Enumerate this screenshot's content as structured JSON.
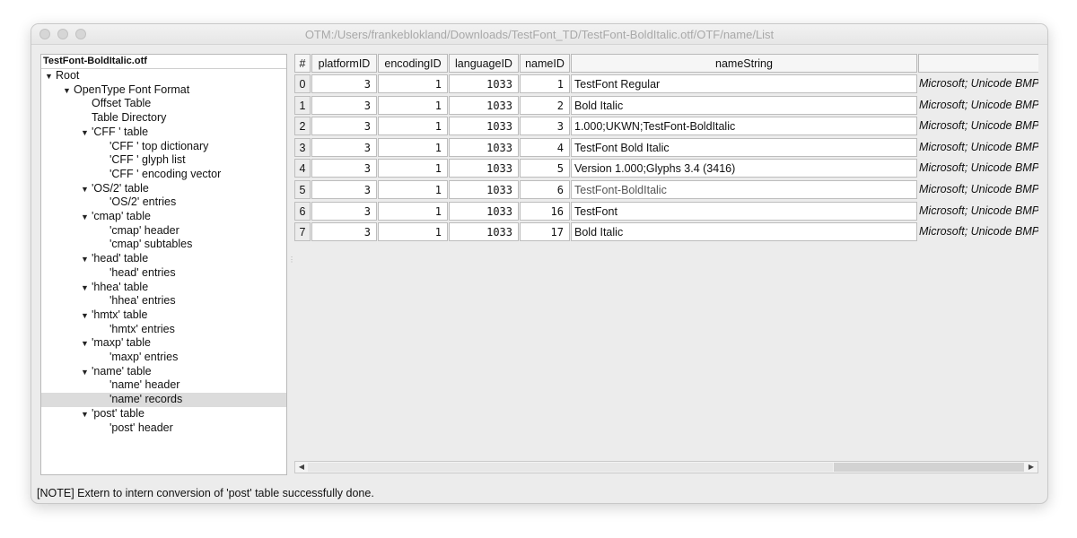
{
  "window": {
    "title": "OTM:/Users/frankeblokland/Downloads/TestFont_TD/TestFont-BoldItalic.otf/OTF/name/List"
  },
  "tree": {
    "header": "TestFont-BoldItalic.otf",
    "items": [
      {
        "label": "Root",
        "expanded": true
      },
      {
        "label": "OpenType Font Format",
        "expanded": true
      },
      {
        "label": "Offset Table"
      },
      {
        "label": "Table Directory"
      },
      {
        "label": "'CFF ' table",
        "expanded": true
      },
      {
        "label": "'CFF ' top dictionary"
      },
      {
        "label": "'CFF ' glyph list"
      },
      {
        "label": "'CFF ' encoding vector"
      },
      {
        "label": "'OS/2' table",
        "expanded": true
      },
      {
        "label": "'OS/2' entries"
      },
      {
        "label": "'cmap' table",
        "expanded": true
      },
      {
        "label": "'cmap' header"
      },
      {
        "label": "'cmap' subtables"
      },
      {
        "label": "'head' table",
        "expanded": true
      },
      {
        "label": "'head' entries"
      },
      {
        "label": "'hhea' table",
        "expanded": true
      },
      {
        "label": "'hhea' entries"
      },
      {
        "label": "'hmtx' table",
        "expanded": true
      },
      {
        "label": "'hmtx' entries"
      },
      {
        "label": "'maxp' table",
        "expanded": true
      },
      {
        "label": "'maxp' entries"
      },
      {
        "label": "'name' table",
        "expanded": true
      },
      {
        "label": "'name' header"
      },
      {
        "label": "'name' records",
        "selected": true
      },
      {
        "label": "'post' table",
        "expanded": true
      },
      {
        "label": "'post' header"
      }
    ]
  },
  "table": {
    "columns": [
      "#",
      "platformID",
      "encodingID",
      "languageID",
      "nameID",
      "nameString",
      ""
    ],
    "rows": [
      {
        "idx": "0",
        "platformID": "3",
        "encodingID": "1",
        "languageID": "1033",
        "nameID": "1",
        "nameString": "TestFont Regular",
        "platform": "Microsoft; Unicode BMP"
      },
      {
        "idx": "1",
        "platformID": "3",
        "encodingID": "1",
        "languageID": "1033",
        "nameID": "2",
        "nameString": "Bold Italic",
        "platform": "Microsoft; Unicode BMP"
      },
      {
        "idx": "2",
        "platformID": "3",
        "encodingID": "1",
        "languageID": "1033",
        "nameID": "3",
        "nameString": "1.000;UKWN;TestFont-BoldItalic",
        "platform": "Microsoft; Unicode BMP"
      },
      {
        "idx": "3",
        "platformID": "3",
        "encodingID": "1",
        "languageID": "1033",
        "nameID": "4",
        "nameString": "TestFont Bold Italic",
        "platform": "Microsoft; Unicode BMP"
      },
      {
        "idx": "4",
        "platformID": "3",
        "encodingID": "1",
        "languageID": "1033",
        "nameID": "5",
        "nameString": "Version 1.000;Glyphs 3.4 (3416)",
        "platform": "Microsoft; Unicode BMP"
      },
      {
        "idx": "5",
        "platformID": "3",
        "encodingID": "1",
        "languageID": "1033",
        "nameID": "6",
        "nameString": "TestFont-BoldItalic",
        "platform": "Microsoft; Unicode BMP"
      },
      {
        "idx": "6",
        "platformID": "3",
        "encodingID": "1",
        "languageID": "1033",
        "nameID": "16",
        "nameString": "TestFont",
        "platform": "Microsoft; Unicode BMP"
      },
      {
        "idx": "7",
        "platformID": "3",
        "encodingID": "1",
        "languageID": "1033",
        "nameID": "17",
        "nameString": "Bold Italic",
        "platform": "Microsoft; Unicode BMP"
      }
    ]
  },
  "status": {
    "message": "[NOTE] Extern to intern conversion of 'post' table successfully done."
  }
}
